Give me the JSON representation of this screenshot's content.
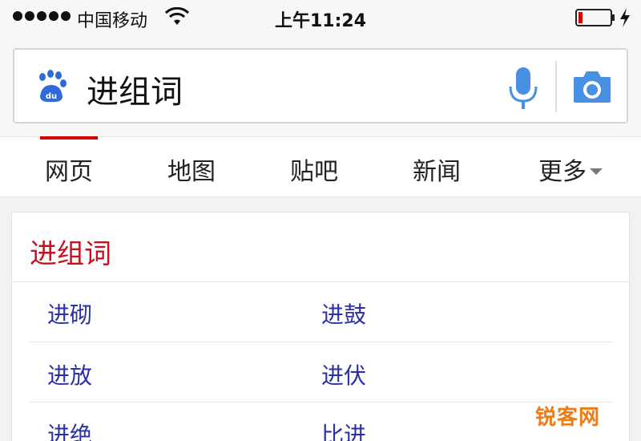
{
  "status_bar": {
    "carrier": "中国移动",
    "time": "上午11:24",
    "signal_dots": 5
  },
  "search": {
    "query": "进组词",
    "logo_icon": "baidu-paw-icon",
    "mic_icon": "microphone-icon",
    "camera_icon": "camera-icon",
    "accent_color": "#4a90e2"
  },
  "tabs": [
    {
      "label": "网页",
      "active": true
    },
    {
      "label": "地图",
      "active": false
    },
    {
      "label": "贴吧",
      "active": false
    },
    {
      "label": "新闻",
      "active": false
    },
    {
      "label": "更多",
      "active": false
    }
  ],
  "result": {
    "title": "进组词",
    "title_color": "#c8101e",
    "words": [
      [
        "进砌",
        "进鼓"
      ],
      [
        "进放",
        "进伏"
      ],
      [
        "进绝",
        "比进"
      ]
    ]
  },
  "watermark": "锐客网"
}
